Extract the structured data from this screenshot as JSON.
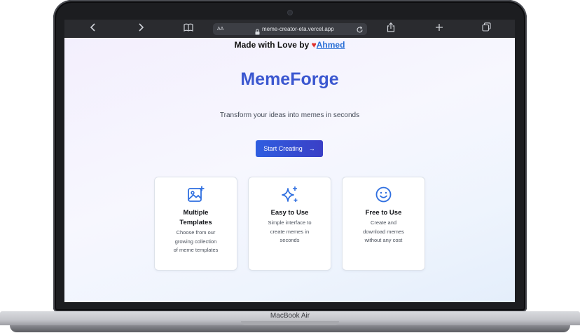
{
  "device": {
    "model_label": "MacBook Air"
  },
  "browser": {
    "text_size_label": "AA",
    "url": "meme-creator-eta.vercel.app",
    "icons": {
      "back": "chevron-left-icon",
      "forward": "chevron-right-icon",
      "reader": "book-icon",
      "lock": "lock-icon",
      "reload": "reload-icon",
      "share": "share-icon",
      "new_tab": "plus-icon",
      "tabs": "tabs-icon"
    }
  },
  "page": {
    "credit_prefix": "Made with Love by",
    "credit_author": "Ahmed",
    "brand": "MemeForge",
    "tagline": "Transform your ideas into memes in seconds",
    "cta_label": "Start Creating",
    "features": [
      {
        "title": "Multiple Templates",
        "title_lines": [
          "Multiple",
          "Templates"
        ],
        "description": "Choose from our growing collection of meme templates",
        "description_lines": [
          "Choose from our",
          "growing collection",
          "of meme templates"
        ],
        "icon": "image-plus-icon"
      },
      {
        "title": "Easy to Use",
        "title_lines": [
          "Easy to Use"
        ],
        "description": "Simple interface to create memes in seconds",
        "description_lines": [
          "Simple interface to",
          "create memes in",
          "seconds"
        ],
        "icon": "sparkles-icon"
      },
      {
        "title": "Free to Use",
        "title_lines": [
          "Free to Use"
        ],
        "description": "Create and download memes without any cost",
        "description_lines": [
          "Create and",
          "download memes",
          "without any cost"
        ],
        "icon": "smile-icon"
      }
    ]
  },
  "colors": {
    "brand": "#3b57d0",
    "cta_start": "#2f5ee0",
    "cta_end": "#3a3fc6",
    "icon_blue": "#2f6fe0",
    "author_link": "#2a6fd6",
    "heart": "#e0302c"
  }
}
